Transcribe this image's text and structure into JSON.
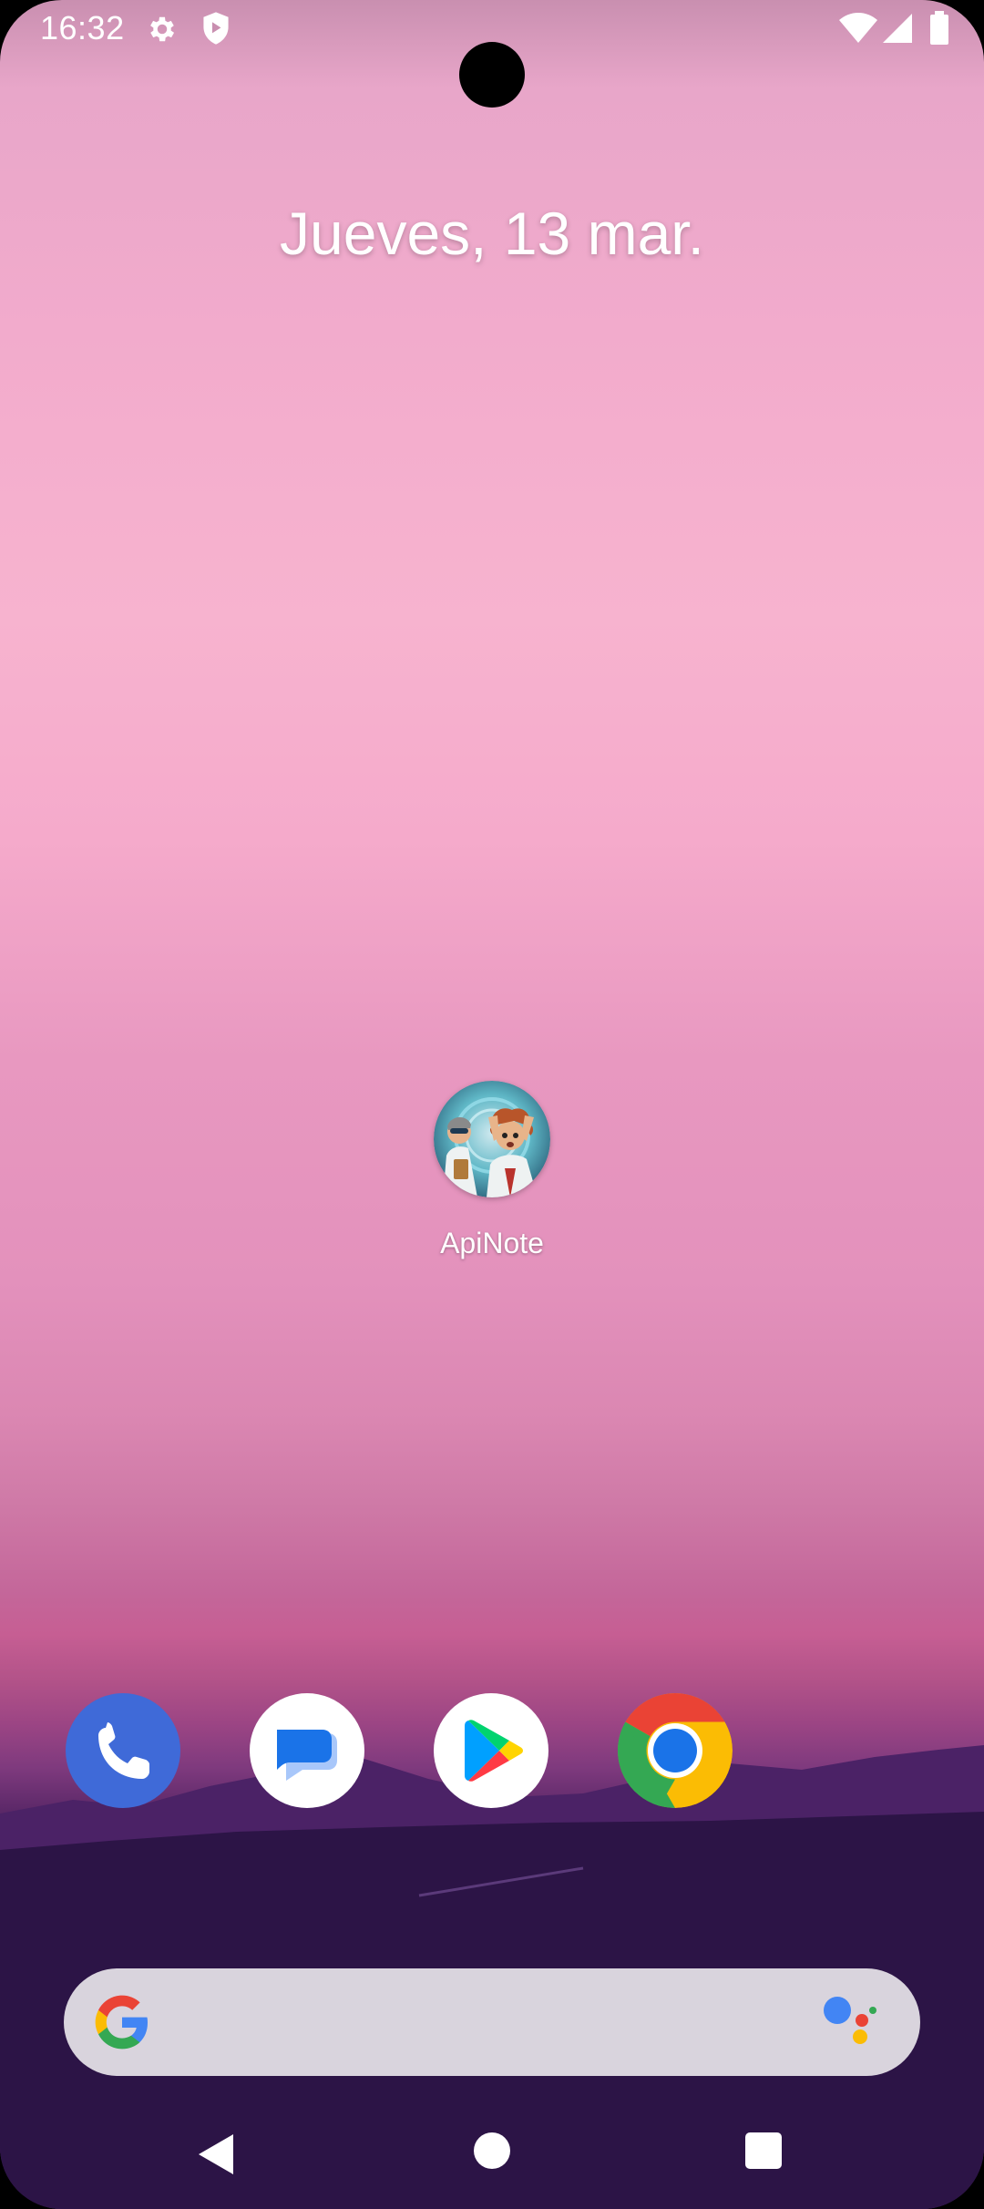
{
  "status_bar": {
    "time": "16:32",
    "icons": [
      "gear-icon",
      "shield-icon",
      "wifi-icon",
      "signal-icon",
      "battery-icon"
    ]
  },
  "home": {
    "date": "Jueves, 13 mar."
  },
  "apps": [
    {
      "label": "ApiNote",
      "icon": "apinote-icon"
    }
  ],
  "dock": {
    "apps": [
      "phone-icon",
      "messages-icon",
      "play-store-icon",
      "chrome-icon"
    ]
  },
  "search_bar": {
    "icons": [
      "google-g-icon",
      "assistant-icon"
    ]
  },
  "nav_bar": {
    "buttons": [
      "back-button",
      "home-button",
      "recents-button"
    ]
  },
  "colors": {
    "wallpaper_top": "#e8a6c9",
    "wallpaper_mid": "#f7b3cf",
    "wallpaper_bottom": "#220e38",
    "search_bar": "#d9d4dd",
    "phone_blue": "#3f6ad8",
    "messages_blue": "#1a73e8"
  }
}
